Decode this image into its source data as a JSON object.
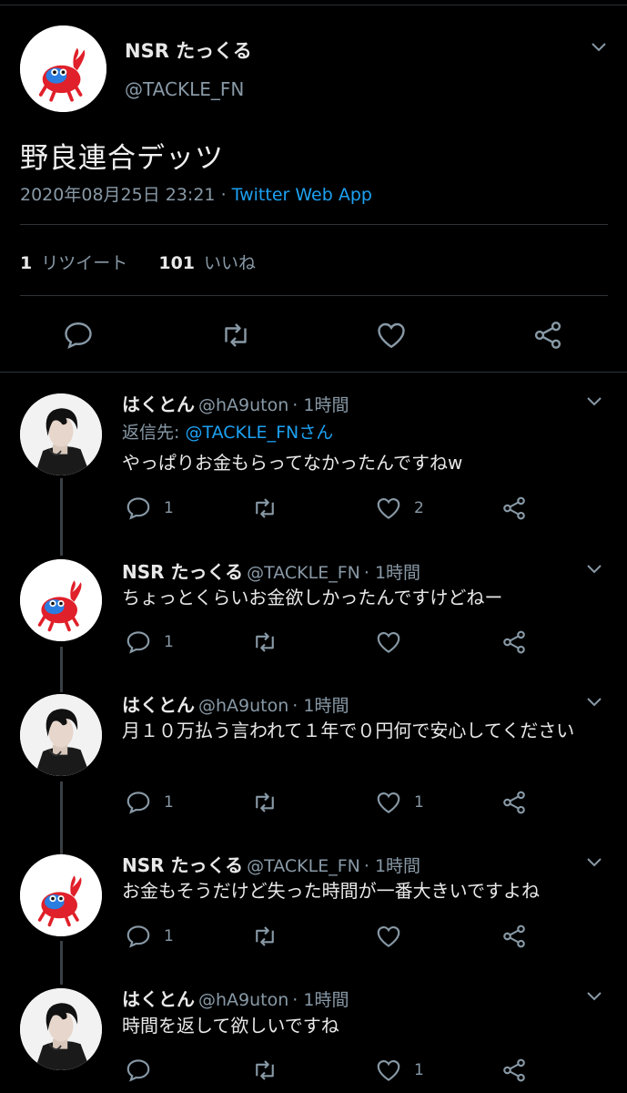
{
  "main_tweet": {
    "name": "NSR たっくる",
    "handle": "@TACKLE_FN",
    "text": "野良連合デッツ",
    "date": "2020年08月25日 23:21",
    "separator": "·",
    "source": "Twitter Web App",
    "retweet_count": "1",
    "retweet_label": "リツイート",
    "like_count": "101",
    "like_label": "いいね"
  },
  "replies": [
    {
      "name": "はくとん",
      "handle": "@hA9uton",
      "time": "· 1時間",
      "reply_to_prefix": "返信先: ",
      "reply_to_user": "@TACKLE_FNさん",
      "text": "やっぱりお金もらってなかったんですねw",
      "reply_count": "1",
      "retweet_count": "",
      "like_count": "2",
      "avatar": "person"
    },
    {
      "name": "NSR たっくる",
      "handle": "@TACKLE_FN",
      "time": "· 1時間",
      "text": "ちょっとくらいお金欲しかったんですけどねー",
      "reply_count": "1",
      "retweet_count": "",
      "like_count": "",
      "avatar": "crab"
    },
    {
      "name": "はくとん",
      "handle": "@hA9uton",
      "time": "· 1時間",
      "text": "月１０万払う言われて１年で０円何で安心してください",
      "reply_count": "1",
      "retweet_count": "",
      "like_count": "1",
      "avatar": "person"
    },
    {
      "name": "NSR たっくる",
      "handle": "@TACKLE_FN",
      "time": "· 1時間",
      "text": "お金もそうだけど失った時間が一番大きいですよね",
      "reply_count": "1",
      "retweet_count": "",
      "like_count": "",
      "avatar": "crab"
    },
    {
      "name": "はくとん",
      "handle": "@hA9uton",
      "time": "· 1時間",
      "text": "時間を返して欲しいですね",
      "reply_count": "",
      "retweet_count": "",
      "like_count": "1",
      "avatar": "person"
    }
  ],
  "icons": [
    "reply-icon",
    "retweet-icon",
    "like-icon",
    "share-icon",
    "chevron-down-icon"
  ],
  "colors": {
    "background": "#000000",
    "link": "#1da1f2",
    "muted": "#8899a6",
    "text": "#e8e8e8",
    "divider": "#2f3336"
  }
}
